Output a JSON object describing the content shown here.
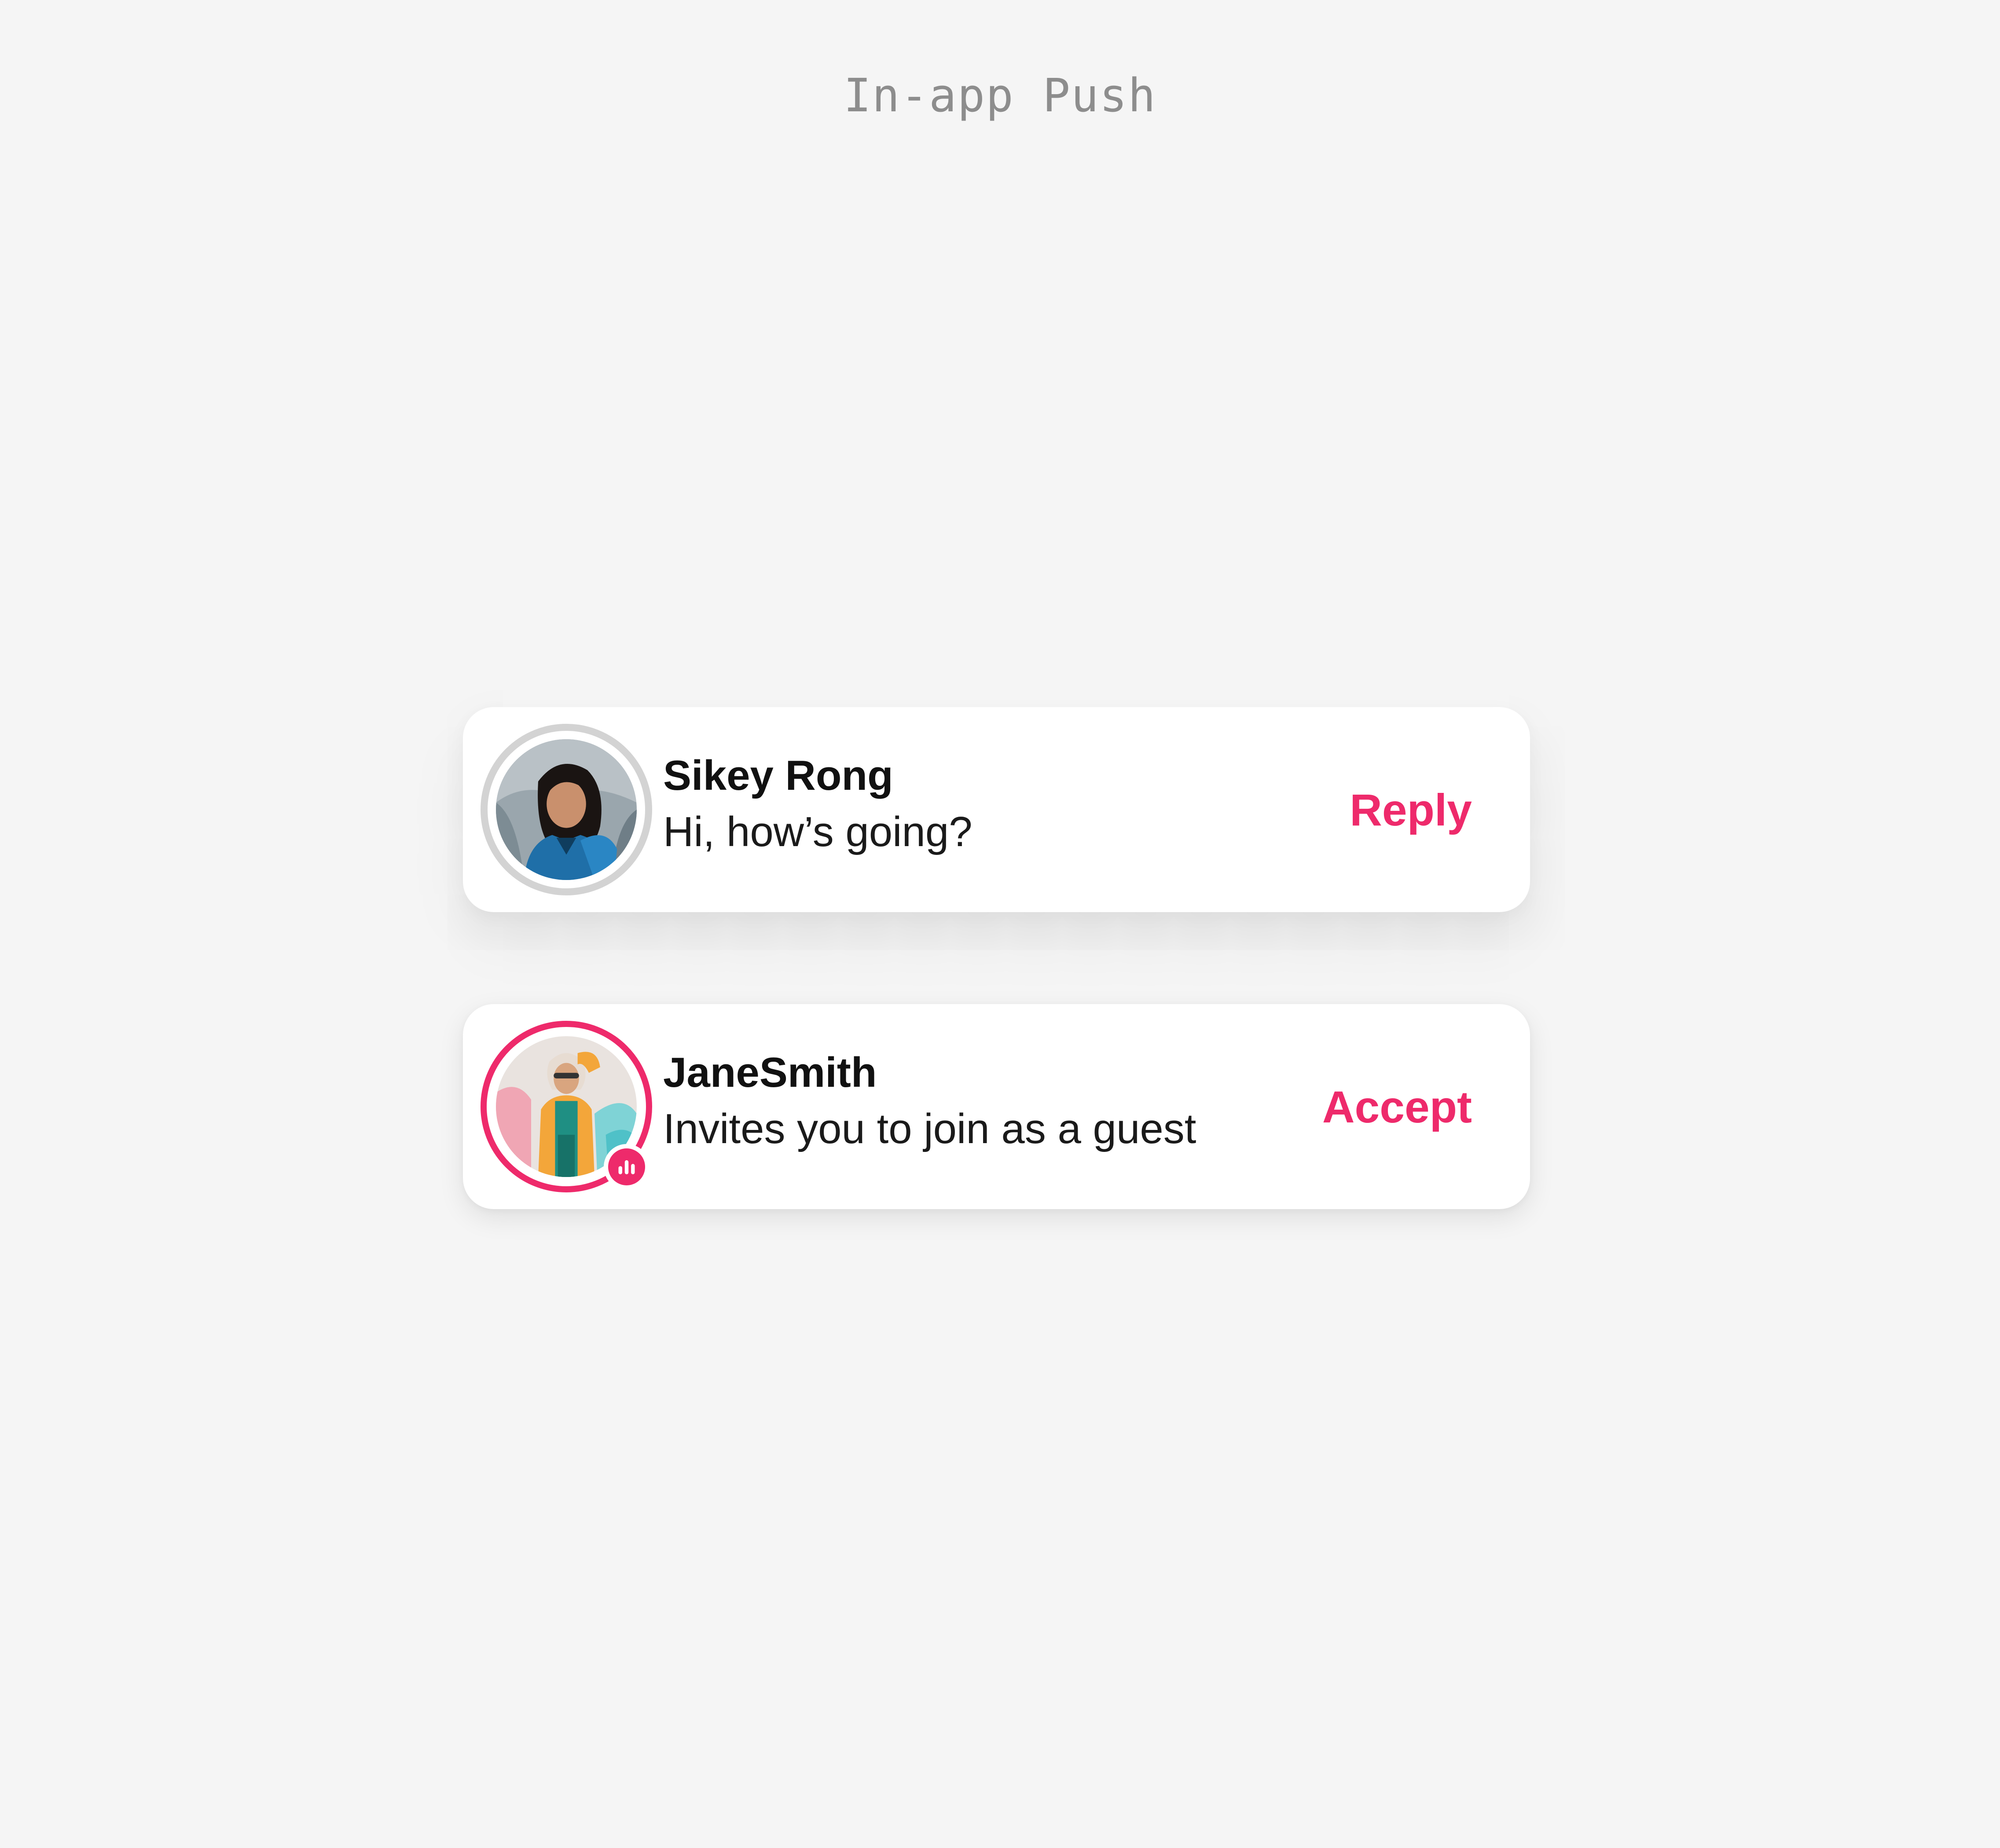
{
  "page": {
    "title": "In-app Push"
  },
  "notifications": [
    {
      "name": "Sikey Rong",
      "message": "Hi, how’s going?",
      "action_label": "Reply",
      "avatar_ring": "grey",
      "live_badge": false
    },
    {
      "name": "JaneSmith",
      "message": "Invites you to join as a guest",
      "action_label": "Accept",
      "avatar_ring": "pink",
      "live_badge": true
    }
  ],
  "colors": {
    "background": "#f5f5f5",
    "card": "#ffffff",
    "accent": "#ee2a6b",
    "ring_grey": "#d3d3d3",
    "title_text": "#8d8d8d"
  },
  "icons": {
    "live_badge": "audio-bars-icon"
  }
}
